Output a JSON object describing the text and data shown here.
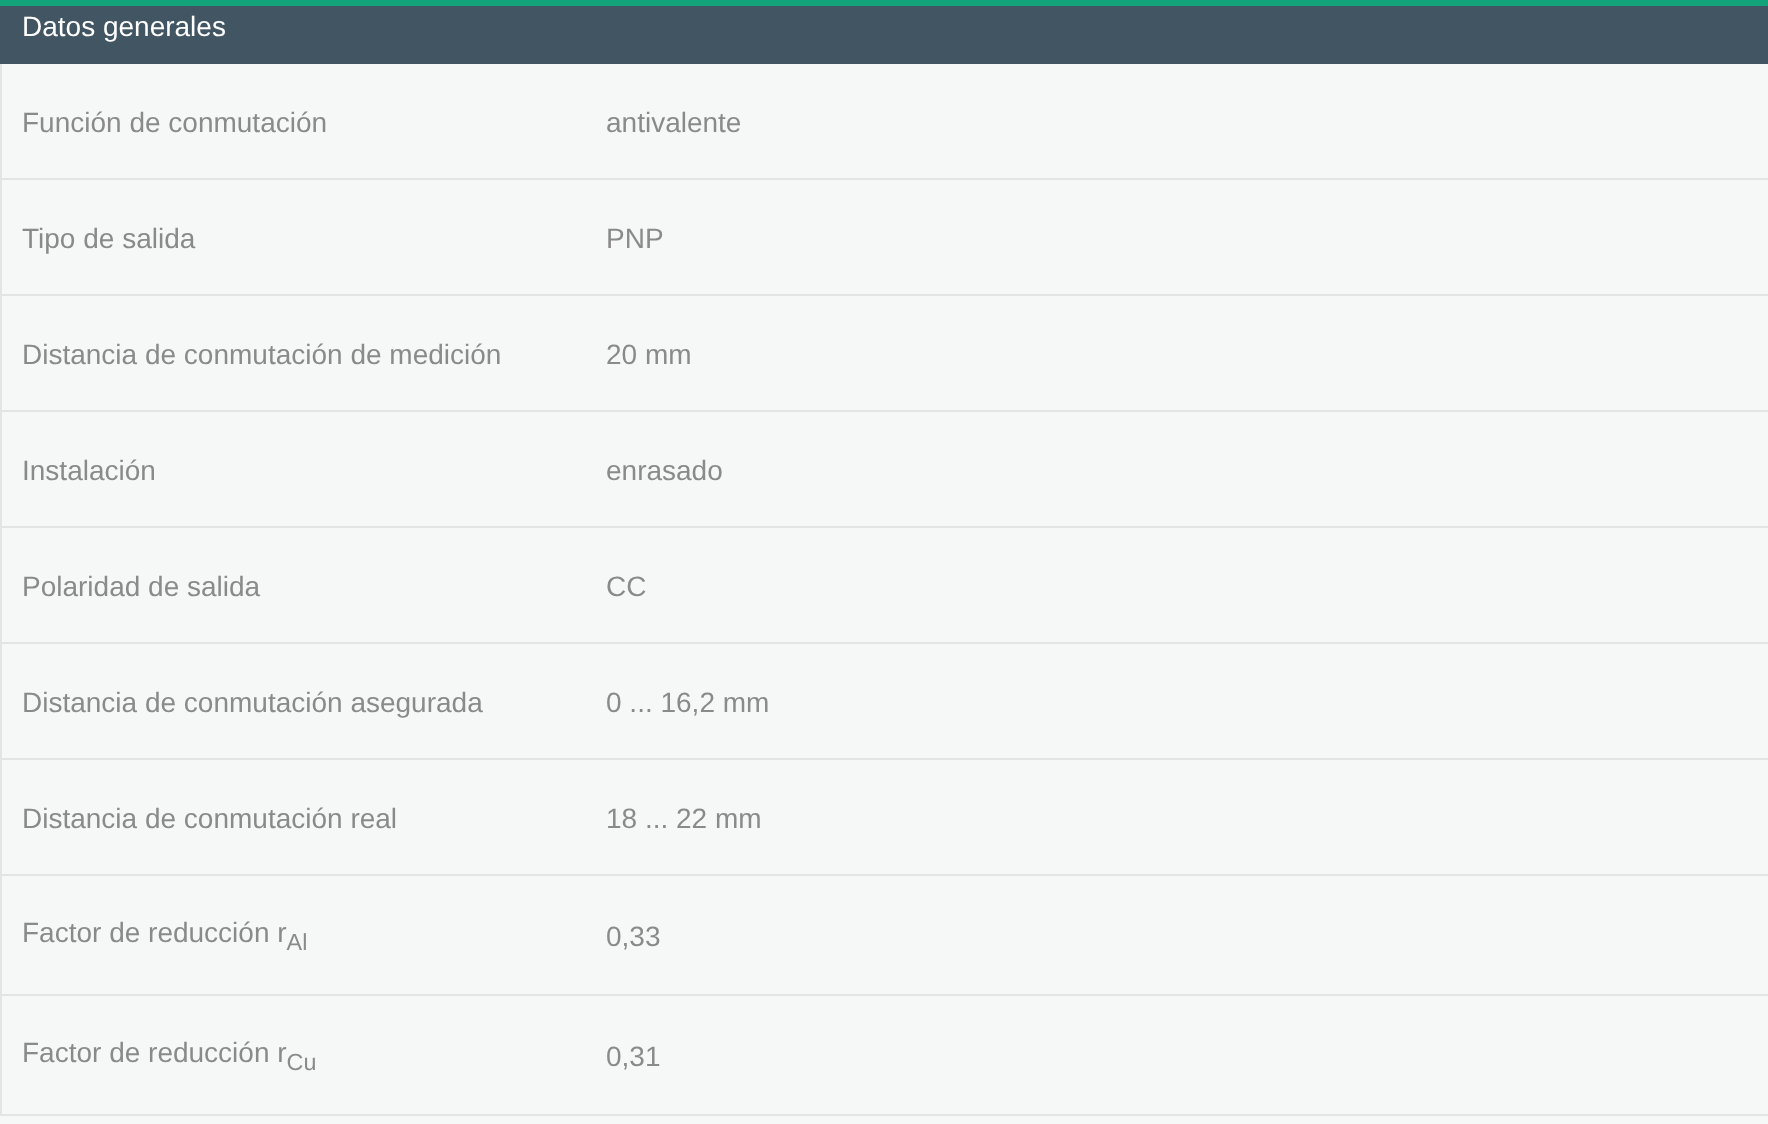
{
  "section": {
    "title": "Datos generales"
  },
  "rows": [
    {
      "label": "Función de conmutación",
      "value": "antivalente"
    },
    {
      "label": "Tipo de salida",
      "value": "PNP"
    },
    {
      "label": "Distancia de conmutación de medición",
      "value": "20 mm"
    },
    {
      "label": "Instalación",
      "value": "enrasado"
    },
    {
      "label": "Polaridad de salida",
      "value": "CC"
    },
    {
      "label": "Distancia de conmutación asegurada",
      "value": "0 ... 16,2 mm"
    },
    {
      "label": "Distancia de conmutación real",
      "value": "18 ... 22 mm"
    },
    {
      "label": "Factor de reducción r$_{Al}$",
      "value": "0,33"
    },
    {
      "label": "Factor de reducción r$_{Cu}$",
      "value": "0,31"
    }
  ]
}
